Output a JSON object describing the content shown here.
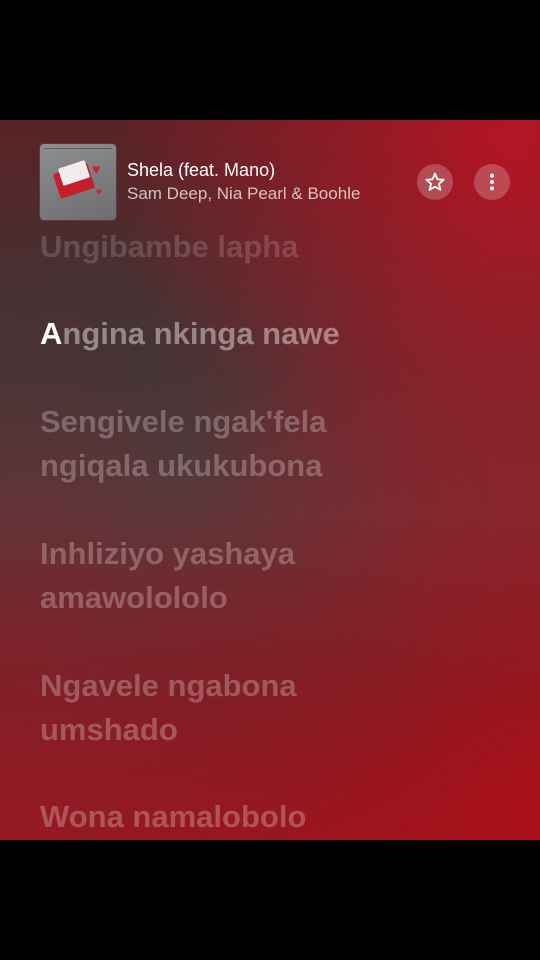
{
  "track": {
    "title": "Shela (feat. Mano)",
    "artist": "Sam Deep, Nia Pearl & Boohle"
  },
  "icons": {
    "favorite": "star-icon",
    "more": "more-vertical-icon"
  },
  "lyrics": {
    "previous": "Ungibambe lapha",
    "current_highlight": "A",
    "current_rest": "ngina nkinga nawe",
    "lines": [
      "Sengivele ngak'fela\nngiqala ukukubona",
      "Inhliziyo yashaya\namawolololo",
      "Ngavele ngabona\numshado",
      "Wona namalobolo"
    ]
  },
  "colors": {
    "accent_red": "#b81420",
    "text_white": "#ffffff"
  }
}
